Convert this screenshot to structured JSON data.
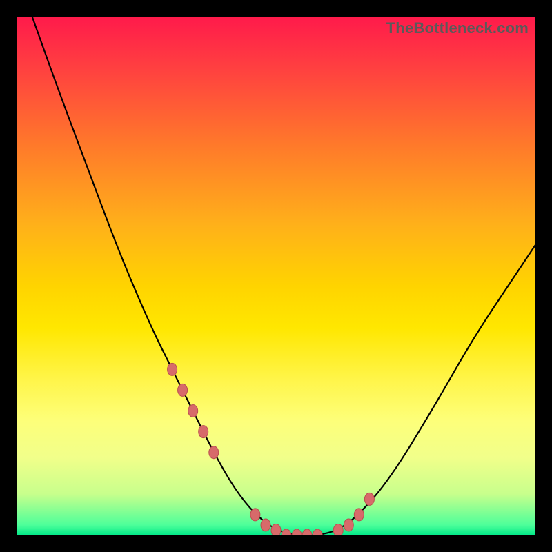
{
  "watermark": "TheBottleneck.com",
  "chart_data": {
    "type": "line",
    "title": "",
    "xlabel": "",
    "ylabel": "",
    "xlim": [
      0,
      100
    ],
    "ylim": [
      0,
      100
    ],
    "grid": false,
    "legend": false,
    "series": [
      {
        "name": "bottleneck-curve",
        "x": [
          3,
          8,
          14,
          20,
          26,
          30,
          34,
          38,
          42,
          46,
          50,
          54,
          58,
          62,
          66,
          72,
          80,
          88,
          96,
          100
        ],
        "y": [
          100,
          86,
          70,
          54,
          40,
          32,
          24,
          16,
          9,
          4,
          1,
          0,
          0,
          1,
          4,
          11,
          24,
          38,
          50,
          56
        ]
      }
    ],
    "scatter_points": {
      "name": "highlighted-points",
      "x": [
        30,
        32,
        34,
        36,
        38,
        46,
        48,
        50,
        52,
        54,
        56,
        58,
        62,
        64,
        66,
        68
      ],
      "y": [
        32,
        28,
        24,
        20,
        16,
        4,
        2,
        1,
        0,
        0,
        0,
        0,
        1,
        2,
        4,
        7
      ]
    },
    "background_gradient": {
      "top": "#ff1a4b",
      "middle": "#ffd400",
      "bottom": "#00e888"
    }
  }
}
